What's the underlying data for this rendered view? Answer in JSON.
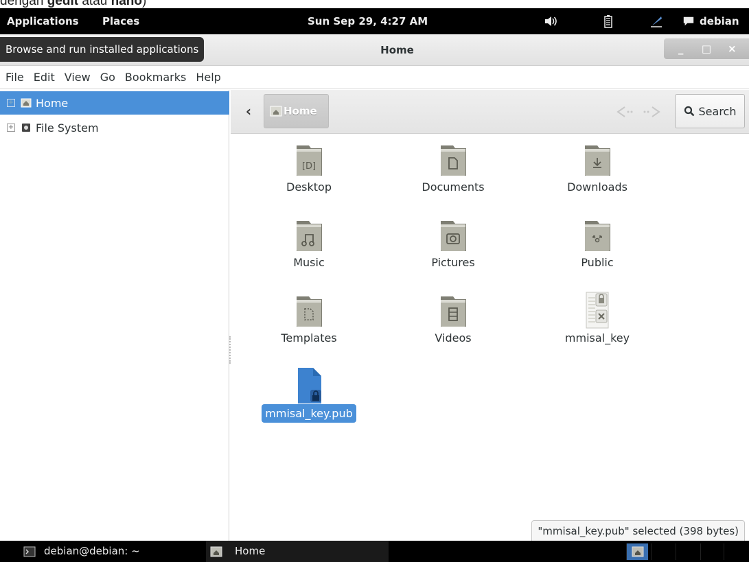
{
  "caption": {
    "prefix": "dengan ",
    "bold1": "gedit",
    "middle": " atau ",
    "bold2": "nano",
    "suffix": ")"
  },
  "top_panel": {
    "applications": "Applications",
    "places": "Places",
    "clock": "Sun Sep 29,  4:27 AM",
    "user": "debian",
    "icons": [
      "volume-icon",
      "battery-icon",
      "accessibility-icon",
      "chat-icon"
    ]
  },
  "window": {
    "title": "Home",
    "tooltip": "Browse and run installed applications",
    "buttons": {
      "minimize": "_",
      "maximize": "□",
      "close": "×"
    }
  },
  "menubar": [
    "File",
    "Edit",
    "View",
    "Go",
    "Bookmarks",
    "Help"
  ],
  "sidebar": {
    "items": [
      {
        "label": "Home",
        "icon": "home-folder-icon",
        "selected": true
      },
      {
        "label": "File System",
        "icon": "drive-icon",
        "selected": false
      }
    ]
  },
  "toolbar": {
    "path": "Home",
    "search_label": "Search"
  },
  "files": [
    {
      "name": "Desktop",
      "icon": "desktop-folder-icon"
    },
    {
      "name": "Documents",
      "icon": "documents-folder-icon"
    },
    {
      "name": "Downloads",
      "icon": "downloads-folder-icon"
    },
    {
      "name": "Music",
      "icon": "music-folder-icon"
    },
    {
      "name": "Pictures",
      "icon": "pictures-folder-icon"
    },
    {
      "name": "Public",
      "icon": "public-folder-icon"
    },
    {
      "name": "Templates",
      "icon": "templates-folder-icon"
    },
    {
      "name": "Videos",
      "icon": "videos-folder-icon"
    },
    {
      "name": "mmisal_key",
      "icon": "private-key-file-icon"
    },
    {
      "name": "mmisal_key.pub",
      "icon": "public-key-file-icon",
      "selected": true
    }
  ],
  "status": "\"mmisal_key.pub\" selected (398 bytes)",
  "taskbar": {
    "terminal": "debian@debian: ~",
    "home": "Home"
  },
  "colors": {
    "selection": "#4a90d9",
    "panel": "#000000",
    "folder": "#8a8a7e"
  }
}
